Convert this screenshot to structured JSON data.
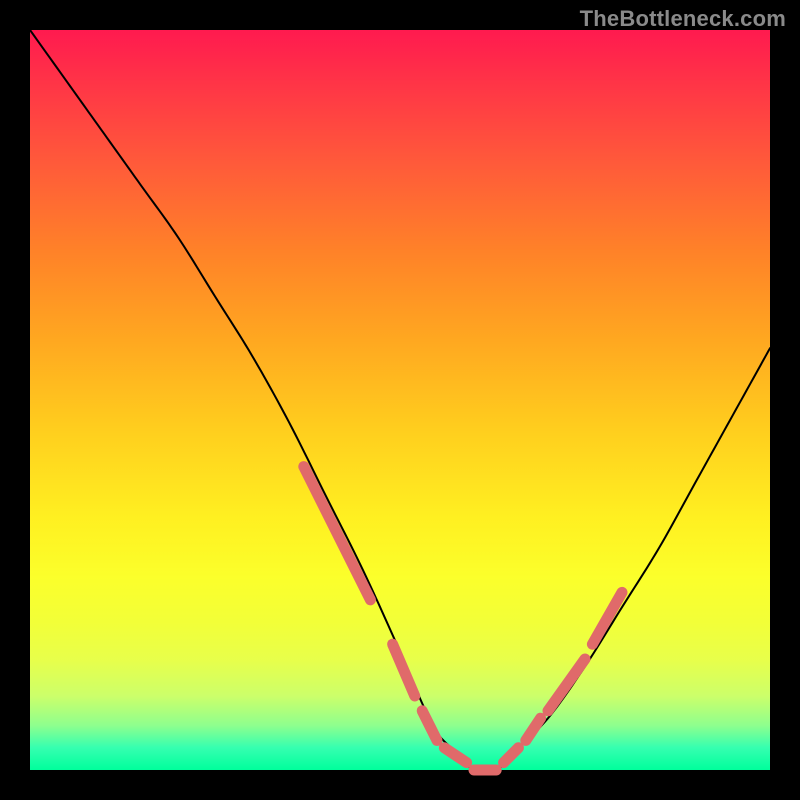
{
  "watermark": "TheBottleneck.com",
  "chart_data": {
    "type": "line",
    "title": "",
    "xlabel": "",
    "ylabel": "",
    "xlim": [
      0,
      100
    ],
    "ylim": [
      0,
      100
    ],
    "series": [
      {
        "name": "bottleneck-curve",
        "x": [
          0,
          5,
          10,
          15,
          20,
          25,
          30,
          35,
          40,
          45,
          50,
          53,
          55,
          58,
          60,
          63,
          65,
          70,
          75,
          80,
          85,
          90,
          95,
          100
        ],
        "y": [
          100,
          93,
          86,
          79,
          72,
          64,
          56,
          47,
          37,
          27,
          16,
          9,
          5,
          2,
          0,
          0,
          2,
          7,
          14,
          22,
          30,
          39,
          48,
          57
        ]
      }
    ],
    "highlights": {
      "name": "optimal-range-markers",
      "color": "#e06a6a",
      "segments": [
        {
          "x": [
            37,
            46
          ],
          "y": [
            41,
            23
          ]
        },
        {
          "x": [
            49,
            52
          ],
          "y": [
            17,
            10
          ]
        },
        {
          "x": [
            53,
            55
          ],
          "y": [
            8,
            4
          ]
        },
        {
          "x": [
            56,
            59
          ],
          "y": [
            3,
            1
          ]
        },
        {
          "x": [
            60,
            63
          ],
          "y": [
            0,
            0
          ]
        },
        {
          "x": [
            64,
            66
          ],
          "y": [
            1,
            3
          ]
        },
        {
          "x": [
            67,
            69
          ],
          "y": [
            4,
            7
          ]
        },
        {
          "x": [
            70,
            75
          ],
          "y": [
            8,
            15
          ]
        },
        {
          "x": [
            76,
            80
          ],
          "y": [
            17,
            24
          ]
        }
      ]
    }
  }
}
